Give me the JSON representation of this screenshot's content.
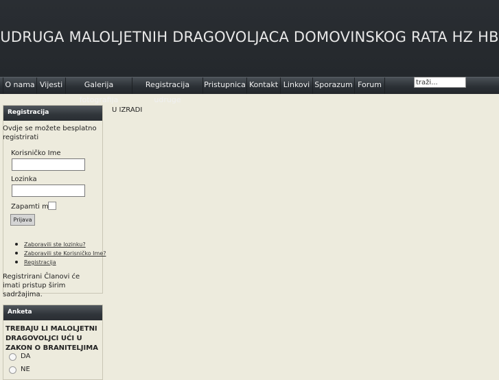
{
  "site": {
    "title": "UDRUGA MALOLJETNIH DRAGOVOLJACA DOMOVINSKOG RATA HZ HB"
  },
  "nav": {
    "items": [
      {
        "label": "O nama"
      },
      {
        "label": "Vijesti"
      },
      {
        "label": "Galerija fotografija"
      },
      {
        "label": "Registracija udruge"
      },
      {
        "label": "Pristupnica"
      },
      {
        "label": "Kontakt"
      },
      {
        "label": "Linkovi"
      },
      {
        "label": "Sporazum"
      },
      {
        "label": "Forum"
      }
    ]
  },
  "search": {
    "value": "traži..."
  },
  "login": {
    "heading": "Registracija",
    "intro": "Ovdje se možete besplatno registrirati",
    "username_label": "Korisničko Ime",
    "password_label": "Lozinka",
    "remember_label": "Zapamti me",
    "button_label": "Prijava",
    "links": [
      {
        "label": "Zaboravili ste lozinku?"
      },
      {
        "label": "Zaboravili ste Korisničko Ime?"
      },
      {
        "label": "Registracija"
      }
    ],
    "footer": "Registrirani Članovi će imati pristup širim sadržajima."
  },
  "poll": {
    "heading": "Anketa",
    "question": "TREBAJU LI MALOLJETNI DRAGOVOLJCI UĆI U ZAKON O BRANITELJIMA",
    "options": [
      {
        "label": "DA"
      },
      {
        "label": "NE"
      }
    ]
  },
  "main": {
    "text": "U IZRADI"
  }
}
